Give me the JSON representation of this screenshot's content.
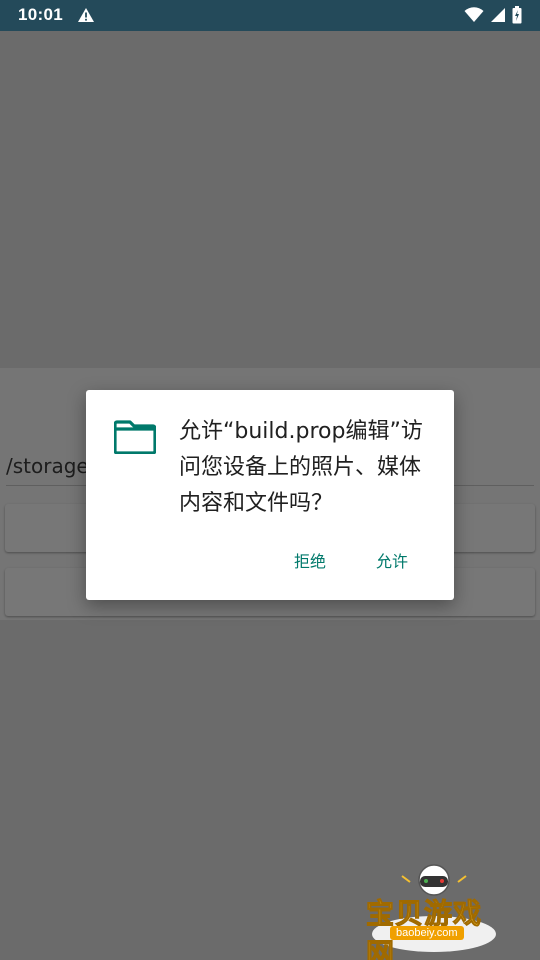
{
  "status_bar": {
    "time": "10:01",
    "icons": [
      "warning-icon",
      "wifi-icon",
      "signal-icon",
      "battery-icon"
    ]
  },
  "background": {
    "path_text": "/storage"
  },
  "dialog": {
    "icon": "folder-icon",
    "message": "允许“build.prop编辑”访问您设备上的照片、媒体内容和文件吗？",
    "deny_label": "拒绝",
    "allow_label": "允许",
    "accent_color": "#00796b"
  },
  "watermark": {
    "title": "宝贝游戏网",
    "url": "baobeiy.com"
  }
}
